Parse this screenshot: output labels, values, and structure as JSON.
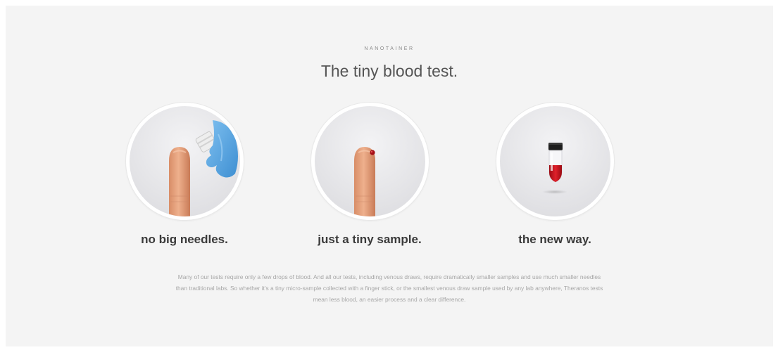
{
  "section": {
    "eyebrow": "NANOTAINER",
    "headline": "The tiny blood test."
  },
  "features": [
    {
      "caption": "no big needles.",
      "icon": "finger-with-lancet-icon"
    },
    {
      "caption": "just a tiny sample.",
      "icon": "finger-with-blood-drop-icon"
    },
    {
      "caption": "the new way.",
      "icon": "nanotainer-tube-icon"
    }
  ],
  "description": "Many of our tests require only a few drops of blood. And all our tests, including venous draws, require dramatically smaller samples and use much smaller needles than traditional labs. So whether it's a tiny micro-sample collected with a finger stick, or the smallest venous draw sample used by any lab anywhere, Theranos tests mean less blood, an easier process and a clear difference.",
  "colors": {
    "panel_background": "#f4f4f4",
    "glove_blue": "#5aa9e6",
    "blood_red": "#c0101a",
    "skin": "#e8a57f"
  }
}
